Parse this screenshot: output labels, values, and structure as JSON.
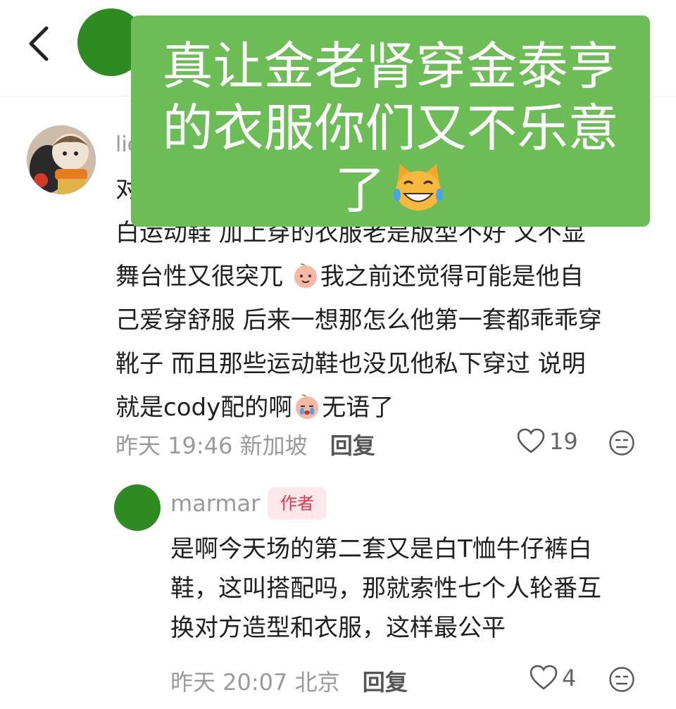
{
  "overlay": {
    "line1": "真让金老肾穿金泰亨",
    "line2": "的衣服你们又不乐意",
    "line3": "了",
    "emoji": "cat-face-with-tears-of-joy"
  },
  "comment": {
    "username": "lie",
    "lines": [
      "对",
      "白运动鞋 加上穿的衣服老是版型不好 又不显",
      "舞台性又很突兀",
      "我之前还觉得可能是他自",
      "己爱穿舒服 后来一想那怎么他第一套都乖乖穿",
      "靴子 而且那些运动鞋也没见他私下穿过 说明",
      "就是cody配的啊",
      "无语了"
    ],
    "time": "昨天 19:46",
    "location": "新加坡",
    "reply_label": "回复",
    "likes": "19"
  },
  "reply": {
    "username": "marmar",
    "badge": "作者",
    "lines": [
      "是啊今天场的第二套又是白T恤牛仔裤白",
      "鞋，这叫搭配吗，那就索性七个人轮番互",
      "换对方造型和衣服，这样最公平"
    ],
    "time": "昨天 20:07",
    "location": "北京",
    "reply_label": "回复",
    "likes": "4"
  },
  "colors": {
    "overlay_bg": "#6cbd55",
    "avatar_green": "#2e8b22",
    "badge_text": "#e8344d",
    "badge_bg": "#fde7ea"
  }
}
